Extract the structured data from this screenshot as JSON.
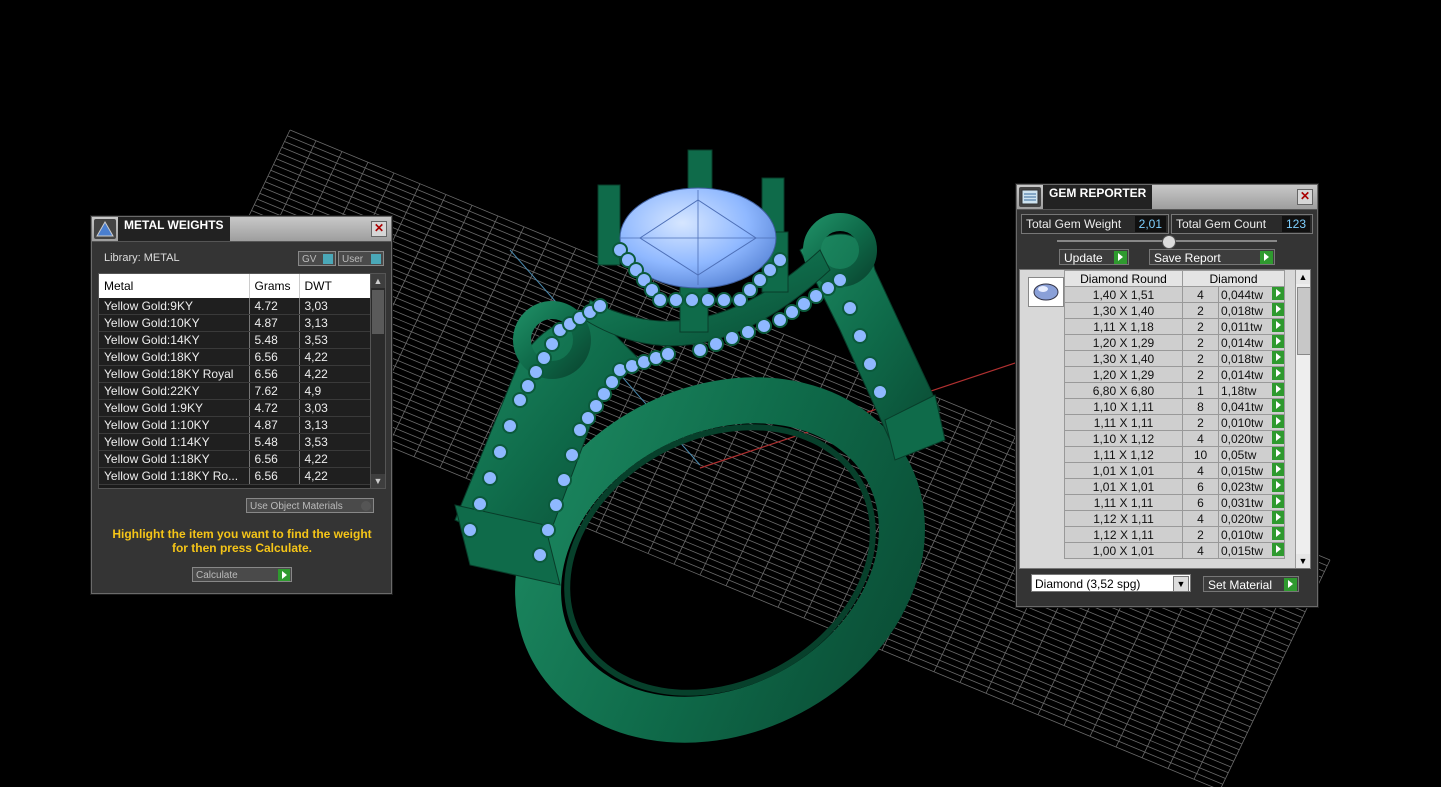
{
  "metal_weights": {
    "title": "METAL WEIGHTS",
    "library_label": "Library: METAL",
    "toggle_gv": "GV",
    "toggle_user": "User",
    "columns": [
      "Metal",
      "Grams",
      "DWT"
    ],
    "rows": [
      [
        "Yellow Gold:9KY",
        "4.72",
        "3,03"
      ],
      [
        "Yellow Gold:10KY",
        "4.87",
        "3,13"
      ],
      [
        "Yellow Gold:14KY",
        "5.48",
        "3,53"
      ],
      [
        "Yellow Gold:18KY",
        "6.56",
        "4,22"
      ],
      [
        "Yellow Gold:18KY Royal",
        "6.56",
        "4,22"
      ],
      [
        "Yellow Gold:22KY",
        "7.62",
        "4,9"
      ],
      [
        "Yellow Gold 1:9KY",
        "4.72",
        "3,03"
      ],
      [
        "Yellow Gold 1:10KY",
        "4.87",
        "3,13"
      ],
      [
        "Yellow Gold 1:14KY",
        "5.48",
        "3,53"
      ],
      [
        "Yellow Gold 1:18KY",
        "6.56",
        "4,22"
      ],
      [
        "Yellow Gold 1:18KY Ro...",
        "6.56",
        "4,22"
      ]
    ],
    "use_object_materials": "Use Object Materials",
    "hint": "Highlight the item you want to find the weight for then press Calculate.",
    "calculate": "Calculate",
    "close_symbol": "✕"
  },
  "gem_reporter": {
    "title": "GEM REPORTER",
    "total_weight_label": "Total Gem Weight",
    "total_weight_value": "2,01",
    "total_count_label": "Total Gem Count",
    "total_count_value": "123",
    "update": "Update",
    "save_report": "Save Report",
    "columns": [
      "Diamond Round",
      "Diamond"
    ],
    "rows": [
      [
        "1,40 X 1,51",
        "4",
        "0,044tw"
      ],
      [
        "1,30 X 1,40",
        "2",
        "0,018tw"
      ],
      [
        "1,11 X 1,18",
        "2",
        "0,011tw"
      ],
      [
        "1,20 X 1,29",
        "2",
        "0,014tw"
      ],
      [
        "1,30 X 1,40",
        "2",
        "0,018tw"
      ],
      [
        "1,20 X 1,29",
        "2",
        "0,014tw"
      ],
      [
        "6,80 X 6,80",
        "1",
        "1,18tw"
      ],
      [
        "1,10 X 1,11",
        "8",
        "0,041tw"
      ],
      [
        "1,11 X 1,11",
        "2",
        "0,010tw"
      ],
      [
        "1,10 X 1,12",
        "4",
        "0,020tw"
      ],
      [
        "1,11 X 1,12",
        "10",
        "0,05tw"
      ],
      [
        "1,01 X 1,01",
        "4",
        "0,015tw"
      ],
      [
        "1,01 X 1,01",
        "6",
        "0,023tw"
      ],
      [
        "1,11 X 1,11",
        "6",
        "0,031tw"
      ],
      [
        "1,12 X 1,11",
        "4",
        "0,020tw"
      ],
      [
        "1,12 X 1,11",
        "2",
        "0,010tw"
      ],
      [
        "1,00 X 1,01",
        "4",
        "0,015tw"
      ]
    ],
    "material_select": "Diamond     (3,52 spg)",
    "set_material": "Set Material",
    "close_symbol": "✕"
  },
  "colors": {
    "ring_green": "#0f6b4a",
    "gem_blue": "#8fb8ff",
    "accent_green_button": "#2f9a2f",
    "hint_yellow": "#f5c518"
  }
}
